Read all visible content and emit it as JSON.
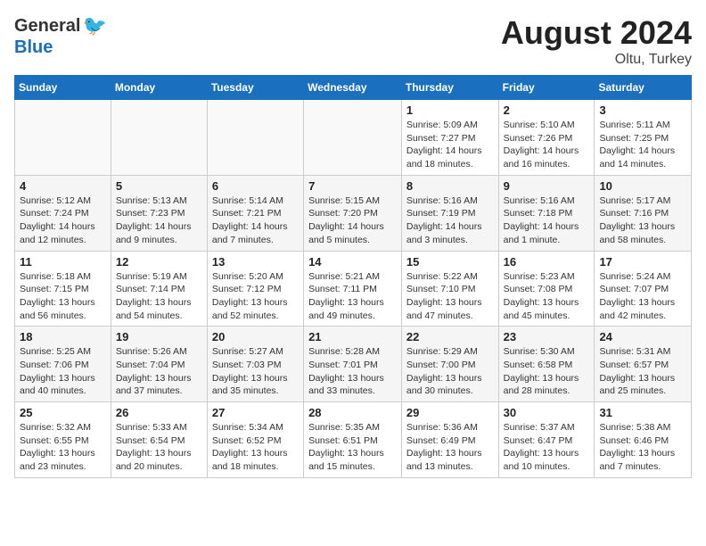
{
  "header": {
    "logo_general": "General",
    "logo_blue": "Blue",
    "month_year": "August 2024",
    "location": "Oltu, Turkey"
  },
  "weekdays": [
    "Sunday",
    "Monday",
    "Tuesday",
    "Wednesday",
    "Thursday",
    "Friday",
    "Saturday"
  ],
  "weeks": [
    [
      {
        "day": "",
        "info": ""
      },
      {
        "day": "",
        "info": ""
      },
      {
        "day": "",
        "info": ""
      },
      {
        "day": "",
        "info": ""
      },
      {
        "day": "1",
        "info": "Sunrise: 5:09 AM\nSunset: 7:27 PM\nDaylight: 14 hours\nand 18 minutes."
      },
      {
        "day": "2",
        "info": "Sunrise: 5:10 AM\nSunset: 7:26 PM\nDaylight: 14 hours\nand 16 minutes."
      },
      {
        "day": "3",
        "info": "Sunrise: 5:11 AM\nSunset: 7:25 PM\nDaylight: 14 hours\nand 14 minutes."
      }
    ],
    [
      {
        "day": "4",
        "info": "Sunrise: 5:12 AM\nSunset: 7:24 PM\nDaylight: 14 hours\nand 12 minutes."
      },
      {
        "day": "5",
        "info": "Sunrise: 5:13 AM\nSunset: 7:23 PM\nDaylight: 14 hours\nand 9 minutes."
      },
      {
        "day": "6",
        "info": "Sunrise: 5:14 AM\nSunset: 7:21 PM\nDaylight: 14 hours\nand 7 minutes."
      },
      {
        "day": "7",
        "info": "Sunrise: 5:15 AM\nSunset: 7:20 PM\nDaylight: 14 hours\nand 5 minutes."
      },
      {
        "day": "8",
        "info": "Sunrise: 5:16 AM\nSunset: 7:19 PM\nDaylight: 14 hours\nand 3 minutes."
      },
      {
        "day": "9",
        "info": "Sunrise: 5:16 AM\nSunset: 7:18 PM\nDaylight: 14 hours\nand 1 minute."
      },
      {
        "day": "10",
        "info": "Sunrise: 5:17 AM\nSunset: 7:16 PM\nDaylight: 13 hours\nand 58 minutes."
      }
    ],
    [
      {
        "day": "11",
        "info": "Sunrise: 5:18 AM\nSunset: 7:15 PM\nDaylight: 13 hours\nand 56 minutes."
      },
      {
        "day": "12",
        "info": "Sunrise: 5:19 AM\nSunset: 7:14 PM\nDaylight: 13 hours\nand 54 minutes."
      },
      {
        "day": "13",
        "info": "Sunrise: 5:20 AM\nSunset: 7:12 PM\nDaylight: 13 hours\nand 52 minutes."
      },
      {
        "day": "14",
        "info": "Sunrise: 5:21 AM\nSunset: 7:11 PM\nDaylight: 13 hours\nand 49 minutes."
      },
      {
        "day": "15",
        "info": "Sunrise: 5:22 AM\nSunset: 7:10 PM\nDaylight: 13 hours\nand 47 minutes."
      },
      {
        "day": "16",
        "info": "Sunrise: 5:23 AM\nSunset: 7:08 PM\nDaylight: 13 hours\nand 45 minutes."
      },
      {
        "day": "17",
        "info": "Sunrise: 5:24 AM\nSunset: 7:07 PM\nDaylight: 13 hours\nand 42 minutes."
      }
    ],
    [
      {
        "day": "18",
        "info": "Sunrise: 5:25 AM\nSunset: 7:06 PM\nDaylight: 13 hours\nand 40 minutes."
      },
      {
        "day": "19",
        "info": "Sunrise: 5:26 AM\nSunset: 7:04 PM\nDaylight: 13 hours\nand 37 minutes."
      },
      {
        "day": "20",
        "info": "Sunrise: 5:27 AM\nSunset: 7:03 PM\nDaylight: 13 hours\nand 35 minutes."
      },
      {
        "day": "21",
        "info": "Sunrise: 5:28 AM\nSunset: 7:01 PM\nDaylight: 13 hours\nand 33 minutes."
      },
      {
        "day": "22",
        "info": "Sunrise: 5:29 AM\nSunset: 7:00 PM\nDaylight: 13 hours\nand 30 minutes."
      },
      {
        "day": "23",
        "info": "Sunrise: 5:30 AM\nSunset: 6:58 PM\nDaylight: 13 hours\nand 28 minutes."
      },
      {
        "day": "24",
        "info": "Sunrise: 5:31 AM\nSunset: 6:57 PM\nDaylight: 13 hours\nand 25 minutes."
      }
    ],
    [
      {
        "day": "25",
        "info": "Sunrise: 5:32 AM\nSunset: 6:55 PM\nDaylight: 13 hours\nand 23 minutes."
      },
      {
        "day": "26",
        "info": "Sunrise: 5:33 AM\nSunset: 6:54 PM\nDaylight: 13 hours\nand 20 minutes."
      },
      {
        "day": "27",
        "info": "Sunrise: 5:34 AM\nSunset: 6:52 PM\nDaylight: 13 hours\nand 18 minutes."
      },
      {
        "day": "28",
        "info": "Sunrise: 5:35 AM\nSunset: 6:51 PM\nDaylight: 13 hours\nand 15 minutes."
      },
      {
        "day": "29",
        "info": "Sunrise: 5:36 AM\nSunset: 6:49 PM\nDaylight: 13 hours\nand 13 minutes."
      },
      {
        "day": "30",
        "info": "Sunrise: 5:37 AM\nSunset: 6:47 PM\nDaylight: 13 hours\nand 10 minutes."
      },
      {
        "day": "31",
        "info": "Sunrise: 5:38 AM\nSunset: 6:46 PM\nDaylight: 13 hours\nand 7 minutes."
      }
    ]
  ]
}
